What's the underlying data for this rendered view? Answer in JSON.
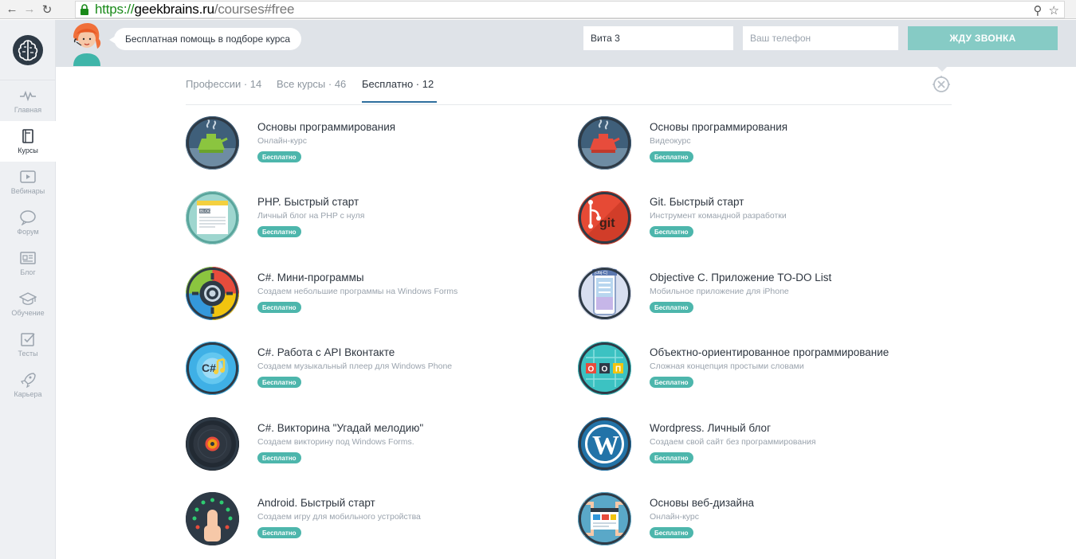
{
  "browser": {
    "url_proto": "https://",
    "url_host": "geekbrains.ru",
    "url_path": "/courses#free"
  },
  "sidebar": {
    "items": [
      {
        "label": "Главная",
        "icon": "pulse-icon"
      },
      {
        "label": "Курсы",
        "icon": "book-icon"
      },
      {
        "label": "Вебинары",
        "icon": "play-icon"
      },
      {
        "label": "Форум",
        "icon": "chat-bubble-icon"
      },
      {
        "label": "Блог",
        "icon": "newspaper-icon"
      },
      {
        "label": "Обучение",
        "icon": "graduation-cap-icon"
      },
      {
        "label": "Тесты",
        "icon": "checkbox-icon"
      },
      {
        "label": "Карьера",
        "icon": "rocket-icon"
      }
    ],
    "active_index": 1
  },
  "callback": {
    "bubble_text": "Бесплатная помощь в подборе курса",
    "name_value": "Вита 3",
    "phone_placeholder": "Ваш телефон",
    "button_label": "ЖДУ ЗВОНКА"
  },
  "tabs": [
    {
      "label": "Профессии · 14"
    },
    {
      "label": "Все курсы · 46"
    },
    {
      "label": "Бесплатно · 12",
      "active": true
    }
  ],
  "badge_label": "Бесплатно",
  "courses": [
    {
      "title": "Основы программирования",
      "subtitle": "Онлайн-курс",
      "icon": "green-kettle-icon"
    },
    {
      "title": "Основы программирования",
      "subtitle": "Видеокурс",
      "icon": "red-kettle-icon"
    },
    {
      "title": "PHP. Быстрый старт",
      "subtitle": "Личный блог на PHP с нуля",
      "icon": "blog-icon"
    },
    {
      "title": "Git. Быстрый старт",
      "subtitle": "Инструмент командной разработки",
      "icon": "git-icon"
    },
    {
      "title": "C#. Мини-программы",
      "subtitle": "Создаем небольшие программы на Windows Forms",
      "icon": "gear-target-icon"
    },
    {
      "title": "Objective C. Приложение TO-DO List",
      "subtitle": "Мобильное приложение для iPhone",
      "icon": "phone-todo-icon"
    },
    {
      "title": "C#. Работа с API Вконтакте",
      "subtitle": "Создаем музыкальный плеер для Windows Phone",
      "icon": "music-icon"
    },
    {
      "title": "Объектно-ориентированное программирование",
      "subtitle": "Сложная концепция простыми словами",
      "icon": "oop-icon"
    },
    {
      "title": "C#. Викторина \"Угадай мелодию\"",
      "subtitle": "Создаем викторину под Windows Forms.",
      "icon": "vinyl-icon"
    },
    {
      "title": "Wordpress. Личный блог",
      "subtitle": "Создаем свой сайт без программирования",
      "icon": "wordpress-icon"
    },
    {
      "title": "Android. Быстрый старт",
      "subtitle": "Создаем игру для мобильного устройства",
      "icon": "touch-icon"
    },
    {
      "title": "Основы веб-дизайна",
      "subtitle": "Онлайн-курс",
      "icon": "webdesign-icon"
    }
  ]
}
